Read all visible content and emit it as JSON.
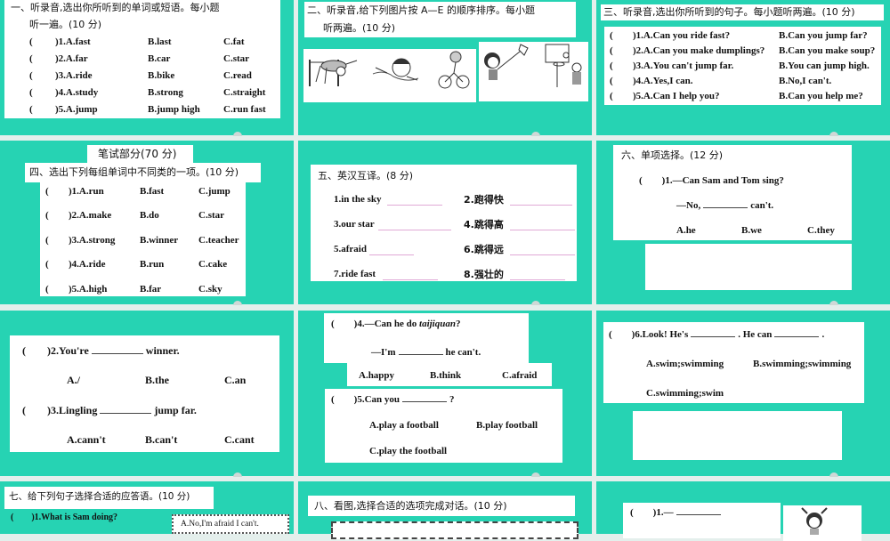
{
  "s1": {
    "title1": "一、听录音,选出你所听到的单词或短语。每小题",
    "title2": "听一遍。(10 分)",
    "rows": [
      [
        "(",
        ")1.A.fast",
        "B.last",
        "C.fat"
      ],
      [
        "(",
        ")2.A.far",
        "B.car",
        "C.star"
      ],
      [
        "(",
        ")3.A.ride",
        "B.bike",
        "C.read"
      ],
      [
        "(",
        ")4.A.study",
        "B.strong",
        "C.straight"
      ],
      [
        "(",
        ")5.A.jump",
        "B.jump high",
        "C.run fast"
      ]
    ]
  },
  "s2": {
    "title1": "二、听录音,给下列图片按 A—E 的顺序排序。每小题",
    "title2": "听两遍。(10 分)",
    "pictures": [
      "high-jump",
      "swimming",
      "cycling",
      "kite-flying",
      "basketball"
    ]
  },
  "s3": {
    "title": "三、听录音,选出你所听到的句子。每小题听两遍。(10 分)",
    "rows": [
      [
        "(",
        ")1.A.Can you ride fast?",
        "B.Can you jump far?"
      ],
      [
        "(",
        ")2.A.Can you make dumplings?",
        "B.Can you make soup?"
      ],
      [
        "(",
        ")3.A.You can't jump far.",
        "B.You can jump high."
      ],
      [
        "(",
        ")4.A.Yes,I can.",
        "B.No,I can't."
      ],
      [
        "(",
        ")5.A.Can I help you?",
        "B.Can you help me?"
      ]
    ]
  },
  "s4": {
    "part": "笔试部分(70 分)",
    "title": "四、选出下列每组单词中不同类的一项。(10 分)",
    "rows": [
      [
        "(",
        ")1.A.run",
        "B.fast",
        "C.jump"
      ],
      [
        "(",
        ")2.A.make",
        "B.do",
        "C.star"
      ],
      [
        "(",
        ")3.A.strong",
        "B.winner",
        "C.teacher"
      ],
      [
        "(",
        ")4.A.ride",
        "B.run",
        "C.cake"
      ],
      [
        "(",
        ")5.A.high",
        "B.far",
        "C.sky"
      ]
    ]
  },
  "s5": {
    "title": "五、英汉互译。(8 分)",
    "items": [
      "1.in the sky",
      "2.跑得快",
      "3.our star",
      "4.跳得高",
      "5.afraid",
      "6.跳得远",
      "7.ride fast",
      "8.强壮的"
    ]
  },
  "s6": {
    "title": "六、单项选择。(12 分)",
    "q1": "(　　)1.—Can Sam and Tom sing?",
    "a1a": "—No,",
    "a1b": "can't.",
    "opts": [
      "A.he",
      "B.we",
      "C.they"
    ]
  },
  "s7": {
    "q2a": "(　　)2.You're",
    "q2b": "winner.",
    "opts2": [
      "A./",
      "B.the",
      "C.an"
    ],
    "q3a": "(　　)3.Lingling",
    "q3b": "jump far.",
    "opts3": [
      "A.cann't",
      "B.can't",
      "C.cant"
    ]
  },
  "s8": {
    "q4a": "(　　)4.—Can he do",
    "q4i": "taijiquan",
    "q4q": "?",
    "a4a": "—I'm",
    "a4b": "he can't.",
    "opts4": [
      "A.happy",
      "B.think",
      "C.afraid"
    ],
    "q5a": "(　　)5.Can you",
    "q5b": "?",
    "opts5": [
      "A.play a football",
      "B.play football",
      "C.play the football"
    ]
  },
  "s9": {
    "q6a": "(　　)6.Look! He's",
    "q6b": ". He can",
    "q6c": ".",
    "opts6": [
      "A.swim;swimming",
      "B.swimming;swimming",
      "C.swimming;swim"
    ]
  },
  "s10": {
    "title": "七、给下列句子选择合适的应答语。(10 分)",
    "q1": "(　　)1.What is Sam doing?",
    "optA": "A.No,I'm afraid I can't."
  },
  "s11": {
    "title": "八、看图,选择合适的选项完成对话。(10 分)"
  },
  "s12": {
    "q1": "(　　)1.—"
  }
}
